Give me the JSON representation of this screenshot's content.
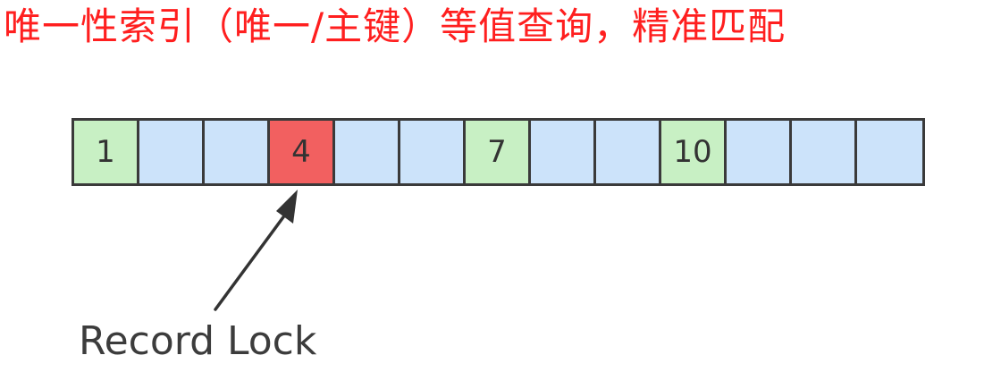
{
  "title": {
    "text": "唯一性索引（唯一/主键）等值查询，精准匹配",
    "color": "#ff1f1f"
  },
  "colors": {
    "plain_cell": "#cce3fa",
    "matched_cell": "#c8f0c4",
    "locked_cell": "#f26060",
    "border": "#3a3a3a",
    "arrow": "#333333"
  },
  "records": [
    {
      "label": "1",
      "state": "matched"
    },
    {
      "label": "",
      "state": "plain"
    },
    {
      "label": "",
      "state": "plain"
    },
    {
      "label": "4",
      "state": "locked"
    },
    {
      "label": "",
      "state": "plain"
    },
    {
      "label": "",
      "state": "plain"
    },
    {
      "label": "7",
      "state": "matched"
    },
    {
      "label": "",
      "state": "plain"
    },
    {
      "label": "",
      "state": "plain"
    },
    {
      "label": "10",
      "state": "matched"
    },
    {
      "label": "",
      "state": "plain"
    },
    {
      "label": "",
      "state": "plain"
    },
    {
      "label": "",
      "state": "plain"
    }
  ],
  "lock": {
    "label": "Record Lock"
  }
}
